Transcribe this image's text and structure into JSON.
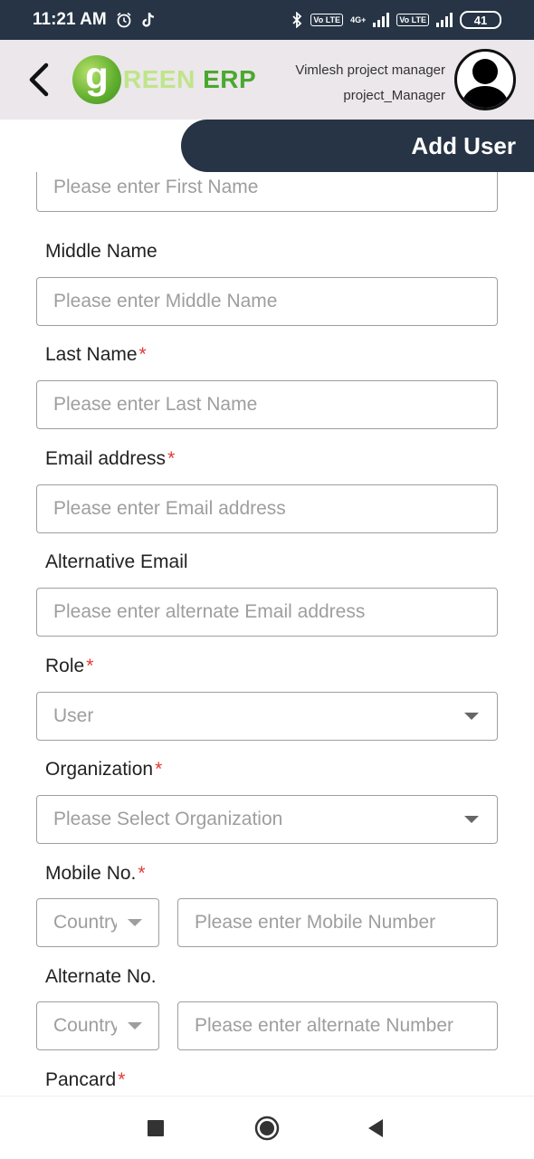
{
  "status_bar": {
    "time": "11:21 AM",
    "network": "4G+",
    "volte1": "Vo LTE",
    "volte2": "Vo LTE",
    "battery": "41"
  },
  "header": {
    "logo_letter": "g",
    "logo_reen": "REEN",
    "logo_erp": "ERP",
    "user_name": "Vimlesh project manager",
    "user_role": "project_Manager"
  },
  "page": {
    "title": "Add User"
  },
  "form": {
    "first_name": {
      "placeholder": "Please enter First Name"
    },
    "middle_name": {
      "label": "Middle Name",
      "placeholder": "Please enter Middle Name"
    },
    "last_name": {
      "label": "Last Name",
      "required": "*",
      "placeholder": "Please enter Last Name"
    },
    "email": {
      "label": "Email address",
      "required": "*",
      "placeholder": "Please enter Email address"
    },
    "alt_email": {
      "label": "Alternative Email",
      "placeholder": "Please enter alternate Email address"
    },
    "role": {
      "label": "Role",
      "required": "*",
      "value": "User"
    },
    "organization": {
      "label": "Organization",
      "required": "*",
      "placeholder": "Please Select Organization"
    },
    "mobile": {
      "label": "Mobile No.",
      "required": "*",
      "country_placeholder": "Country",
      "placeholder": "Please enter Mobile Number"
    },
    "alternate": {
      "label": "Alternate No.",
      "country_placeholder": "Country",
      "placeholder": "Please enter alternate Number"
    },
    "pancard": {
      "label": "Pancard",
      "required": "*"
    }
  },
  "colors": {
    "header_dark": "#263445",
    "header_light": "#ebe7ea",
    "required": "#e53935",
    "logo_green": "#4aa82f"
  }
}
